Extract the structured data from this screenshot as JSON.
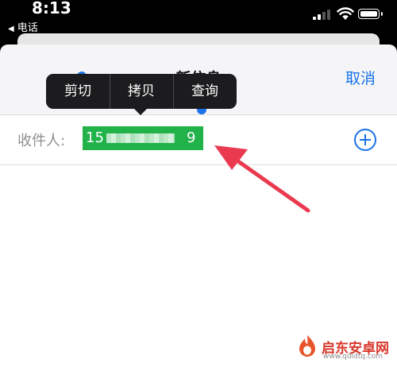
{
  "status_bar": {
    "time": "8:13",
    "back_app": "电话"
  },
  "nav": {
    "title": "新信息",
    "cancel_label": "取消"
  },
  "recipient": {
    "label": "收件人:",
    "selected_start": "15",
    "selected_end": "9"
  },
  "context_menu": {
    "items": [
      "剪切",
      "拷贝",
      "查询"
    ]
  },
  "icons": {
    "add": "plus-circle-icon",
    "back": "back-arrow-icon"
  },
  "colors": {
    "accent": "#1a73e8",
    "selection": "#21b24a",
    "arrow": "#ea3a4f",
    "menu": "#1c1c1e"
  },
  "watermark": {
    "name": "启东安卓网",
    "url": "www.qdldtq.com"
  }
}
